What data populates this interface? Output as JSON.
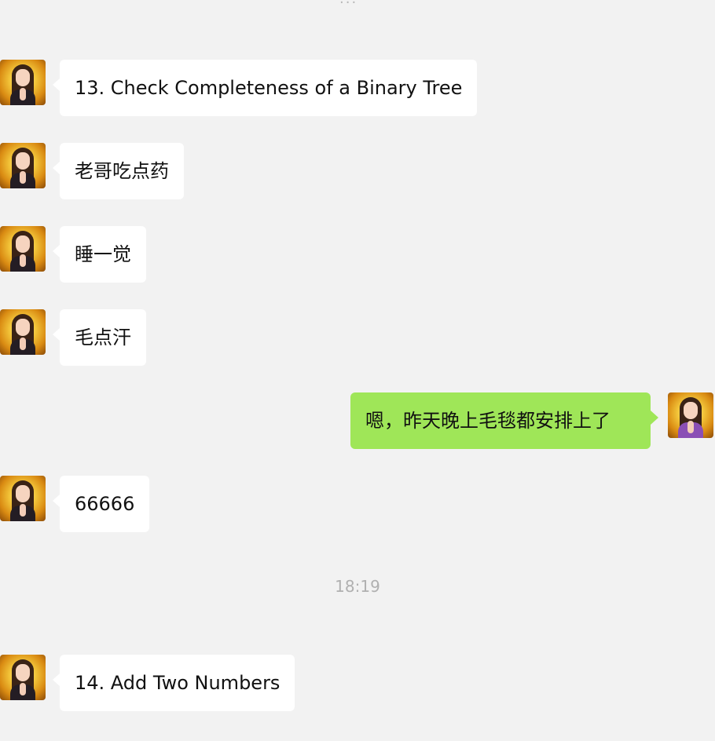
{
  "top_fragment": "...",
  "messages": [
    {
      "side": "left",
      "text": "13. Check Completeness of a Binary Tree"
    },
    {
      "side": "left",
      "text": "老哥吃点药"
    },
    {
      "side": "left",
      "text": "睡一觉"
    },
    {
      "side": "left",
      "text": "毛点汗"
    },
    {
      "side": "right",
      "text": "嗯，昨天晚上毛毯都安排上了"
    },
    {
      "side": "left",
      "text": "66666"
    },
    {
      "side": "left",
      "text": "14. Add Two Numbers"
    }
  ],
  "timestamp": "18:19",
  "colors": {
    "background": "#f2f2f2",
    "incoming_bubble": "#ffffff",
    "outgoing_bubble": "#9fe658",
    "timestamp_text": "#b0b0b0"
  },
  "icons": {
    "left_avatar": "avatar-woman-gold-background",
    "right_avatar": "avatar-woman-purple-outfit"
  }
}
